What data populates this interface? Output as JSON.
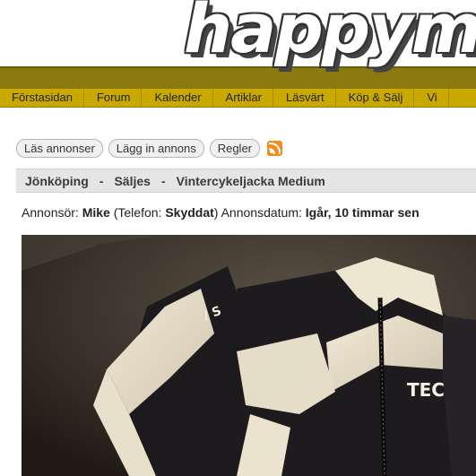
{
  "header": {
    "logo_text": "happymtb"
  },
  "nav": {
    "items": [
      "Förstasidan",
      "Forum",
      "Kalender",
      "Artiklar",
      "Läsvärt",
      "Köp & Sälj",
      "Vi"
    ]
  },
  "actions": {
    "read_ads": "Läs annonser",
    "post_ad": "Lägg in annons",
    "rules": "Regler",
    "rss_icon": "rss-icon"
  },
  "breadcrumb": {
    "location": "Jönköping",
    "sep1": "-",
    "category": "Säljes",
    "sep2": "-",
    "title": "Vintercykeljacka Medium"
  },
  "meta": {
    "advertiser_label": "Annonsör:",
    "advertiser": "Mike",
    "phone_open": "(Telefon:",
    "phone": "Skyddat",
    "phone_close": ")",
    "date_label": "Annonsdatum:",
    "date": "Igår, 10 timmar sen"
  },
  "photo": {
    "jacket_text": "TEC"
  }
}
